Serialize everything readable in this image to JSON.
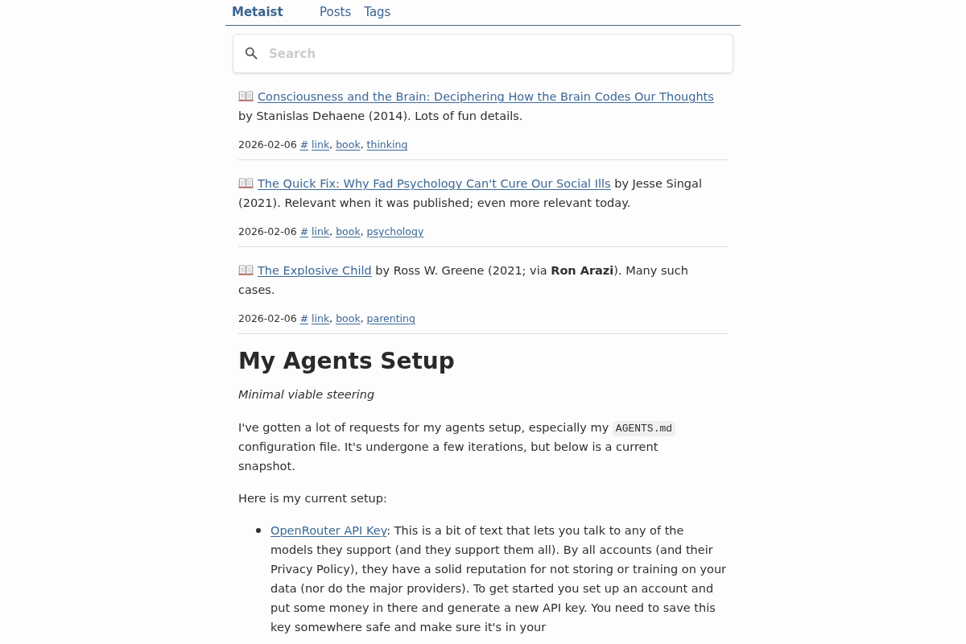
{
  "nav": {
    "brand": "Metaist",
    "links": [
      "Posts",
      "Tags"
    ]
  },
  "search": {
    "placeholder": "Search"
  },
  "posts": [
    {
      "title": "Consciousness and the Brain: Deciphering How the Brain Codes Our Thoughts",
      "text": " by Stanislas Dehaene (2014). Lots of fun details.",
      "date": "2026-02-06",
      "permalink": "#",
      "tags": [
        {
          "label": "link",
          "separator": ","
        },
        {
          "label": "book",
          "separator": ","
        },
        {
          "label": "thinking"
        }
      ]
    },
    {
      "title": "The Quick Fix: Why Fad Psychology Can't Cure Our Social Ills",
      "text": " by Jesse Singal (2021). Relevant when it was published; even more relevant today.",
      "date": "2026-02-06",
      "permalink": "#",
      "tags": [
        {
          "label": "link",
          "separator": ","
        },
        {
          "label": "book",
          "separator": ","
        },
        {
          "label": "psychology"
        }
      ]
    },
    {
      "title": "The Explosive Child",
      "text": " by Ross W. Greene (2021; via **Ron Arazi**). Many such cases.",
      "date": "2026-02-06",
      "permalink": "#",
      "tags": [
        {
          "label": "link",
          "separator": ","
        },
        {
          "label": "book",
          "separator": ","
        },
        {
          "label": "parenting"
        }
      ]
    }
  ],
  "article": {
    "title": "My Agents Setup",
    "subtitle": "Minimal viable steering",
    "intro": {
      "before": "I've gotten a lot of requests for my agents setup, especially my ",
      "code": "AGENTS.md",
      "after": " configuration file. It's undergone a few iterations, but below is a current snapshot."
    },
    "paragraph": "Here is my current setup:",
    "list": [
      {
        "link": "OpenRouter API Key",
        "text": ": This is a bit of text that lets you talk to any of the models they support (and they support them all). By all accounts (and their Privacy Policy), they have a solid reputation for not storing or training on your data (nor do the major providers). To get started you set up an account and put some money in there and generate a new API key. You need to save this key somewhere safe and make sure it's in your"
      }
    ]
  }
}
